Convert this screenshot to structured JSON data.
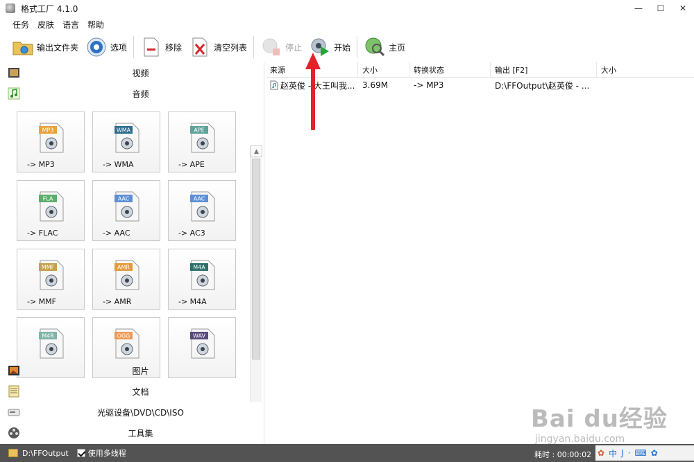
{
  "window": {
    "title": "格式工厂 4.1.0"
  },
  "menu": [
    "任务",
    "皮肤",
    "语言",
    "帮助"
  ],
  "toolbar": {
    "output_folder": "输出文件夹",
    "options": "选项",
    "remove": "移除",
    "clear_list": "清空列表",
    "stop": "停止",
    "start": "开始",
    "home": "主页"
  },
  "categories": {
    "video": "视频",
    "audio": "音频",
    "picture": "图片",
    "document": "文档",
    "rom_device": "光驱设备\\DVD\\CD\\ISO",
    "tools": "工具集"
  },
  "formats": [
    {
      "tag": "MP3",
      "label": "-> MP3",
      "color": "#e8a33c"
    },
    {
      "tag": "WMA",
      "label": "-> WMA",
      "color": "#2f6d8f"
    },
    {
      "tag": "APE",
      "label": "-> APE",
      "color": "#5fa39a"
    },
    {
      "tag": "FLA",
      "label": "-> FLAC",
      "color": "#5cae6b"
    },
    {
      "tag": "AAC",
      "label": "-> AAC",
      "color": "#5d8fd4"
    },
    {
      "tag": "AAC",
      "label": "-> AC3",
      "color": "#5d8fd4"
    },
    {
      "tag": "MMF",
      "label": "-> MMF",
      "color": "#c4a04a"
    },
    {
      "tag": "AMR",
      "label": "-> AMR",
      "color": "#e39a3a"
    },
    {
      "tag": "M4A",
      "label": "-> M4A",
      "color": "#2c6f6a"
    },
    {
      "tag": "M4R",
      "label": "",
      "color": "#7fb3a8"
    },
    {
      "tag": "OGG",
      "label": "",
      "color": "#ef9a55"
    },
    {
      "tag": "WAV",
      "label": "",
      "color": "#5a4a7a"
    }
  ],
  "table": {
    "headers": [
      "来源",
      "大小",
      "转换状态",
      "输出 [F2]",
      "大小"
    ],
    "rows": [
      {
        "source": "赵英俊 - 大王叫我...",
        "size": "3.69M",
        "status": "-> MP3",
        "output": "D:\\FFOutput\\赵英俊 - ...",
        "out_size": ""
      }
    ]
  },
  "status": {
    "output_path": "D:\\FFOutput",
    "multithread_label": "使用多线程",
    "multithread_checked": true,
    "elapsed": "耗时 : 00:00:02"
  },
  "tray": [
    "中",
    "J",
    "·",
    "⌨",
    "✿"
  ],
  "watermark": {
    "main": "Bai du经验",
    "sub": "jingyan.baidu.com"
  },
  "colors": {
    "statusbar": "#535353",
    "arrow": "#e3222a"
  }
}
